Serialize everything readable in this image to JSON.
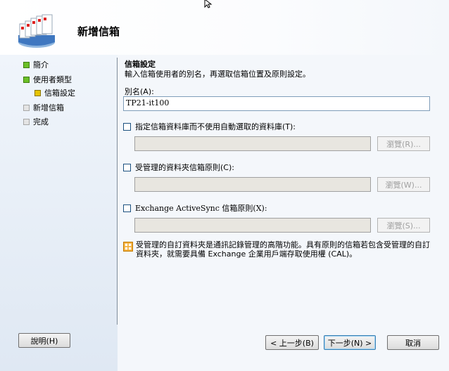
{
  "header": {
    "title": "新增信箱"
  },
  "nav": {
    "items": [
      {
        "label": "簡介",
        "state": "done"
      },
      {
        "label": "使用者類型",
        "state": "done"
      },
      {
        "label": "信箱設定",
        "state": "current"
      },
      {
        "label": "新增信箱",
        "state": "pending"
      },
      {
        "label": "完成",
        "state": "pending"
      }
    ]
  },
  "main": {
    "section_title": "信箱設定",
    "description": "輸入信箱使用者的別名，再選取信箱位置及原則設定。",
    "alias_label": "別名(A):",
    "alias_value": "TP21-it100",
    "option1_label": "指定信箱資料庫而不使用自動選取的資料庫(T):",
    "option2_label": "受管理的資料夾信箱原則(C):",
    "option3_label": "Exchange ActiveSync 信箱原則(X):",
    "browse1_label": "瀏覽(R)...",
    "browse2_label": "瀏覽(W)...",
    "browse3_label": "瀏覽(S)...",
    "info_text": "受管理的自訂資料夾是通訊記錄管理的高階功能。具有原則的信箱若包含受管理的自訂資料夾，就需要具備 Exchange 企業用戶端存取使用權 (CAL)。"
  },
  "footer": {
    "help_label": "說明(H)",
    "back_label": "< 上一步(B)",
    "next_label": "下一步(N) >",
    "cancel_label": "取消"
  },
  "colors": {
    "done": "#6bbf26",
    "current": "#e6c400",
    "pending": "#e4e4e4",
    "info": "#f4b03a"
  }
}
